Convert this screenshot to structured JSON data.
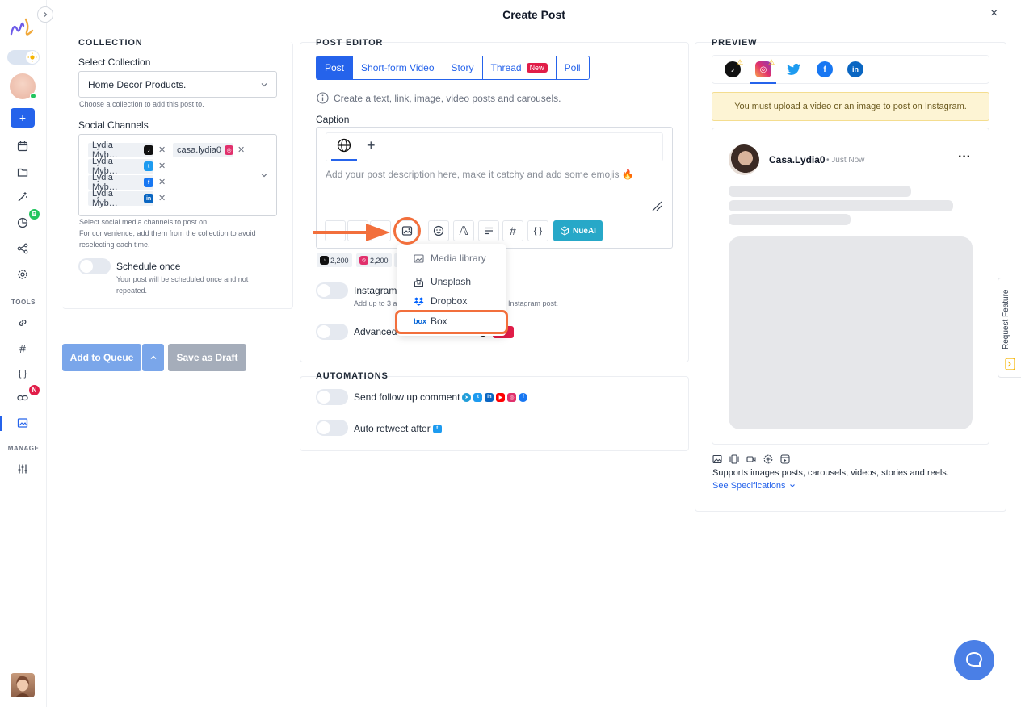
{
  "header": {
    "title": "Create Post",
    "close_icon": "×"
  },
  "sidebar": {
    "tools_label": "TOOLS",
    "manage_label": "MANAGE",
    "analytics_badge": "B",
    "links_badge": "N"
  },
  "collection": {
    "section": "COLLECTION",
    "select_label": "Select Collection",
    "select_value": "Home Decor Products.",
    "select_hint": "Choose a collection to add this post to.",
    "channels_label": "Social Channels",
    "channels": [
      {
        "label": "Lydia Myb…",
        "network": "tiktok"
      },
      {
        "label": "casa.lydia0",
        "network": "instagram"
      },
      {
        "label": "Lydia Myb…",
        "network": "twitter"
      },
      {
        "label": "Lydia Myb…",
        "network": "facebook"
      },
      {
        "label": "Lydia Myb…",
        "network": "linkedin"
      }
    ],
    "channels_hint_1": "Select social media channels to post on.",
    "channels_hint_2": "For convenience, add them from the collection to avoid",
    "channels_hint_3": "reselecting each time.",
    "schedule_label": "Schedule once",
    "schedule_hint_1": "Your post will be scheduled once and not",
    "schedule_hint_2": "repeated."
  },
  "actions": {
    "add_to_queue": "Add to Queue",
    "save_as_draft": "Save as Draft"
  },
  "editor": {
    "section": "POST EDITOR",
    "tabs": [
      "Post",
      "Short-form Video",
      "Story",
      "Thread",
      "Poll"
    ],
    "new_badge": "New",
    "info_text": "Create a text, link, image, video posts and carousels.",
    "caption_label": "Caption",
    "placeholder": "Add your post description here, make it catchy and add some emojis 🔥",
    "nueai_label": "NueAI",
    "count_tiktok": "2,200",
    "count_instagram": "2,200",
    "instagram_toggle_label": "Instagram",
    "instagram_hint": "Add up to 3 a",
    "instagram_hint_tail": "Instagram post.",
    "advanced_label": "Advanced"
  },
  "media_dropdown": {
    "items": [
      "Media library",
      "Unsplash",
      "Dropbox",
      "Box"
    ],
    "box_logo": "box"
  },
  "automations": {
    "section": "AUTOMATIONS",
    "follow_up": "Send follow up comment",
    "auto_retweet": "Auto retweet after"
  },
  "preview": {
    "section": "PREVIEW",
    "platforms": [
      "tiktok",
      "instagram",
      "twitter",
      "facebook",
      "linkedin"
    ],
    "warning": "You must upload a video or an image to post on Instagram.",
    "account_name": "Casa.Lydia0",
    "timestamp": "• Just Now",
    "menu": "···",
    "supports_text": "Supports images posts, carousels, videos, stories and reels.",
    "spec_link": "See Specifications"
  },
  "request_feature": "Request Feature",
  "colors": {
    "primary": "#2563eb",
    "annotation": "#f26f3c",
    "teal": "#27a8c8"
  }
}
